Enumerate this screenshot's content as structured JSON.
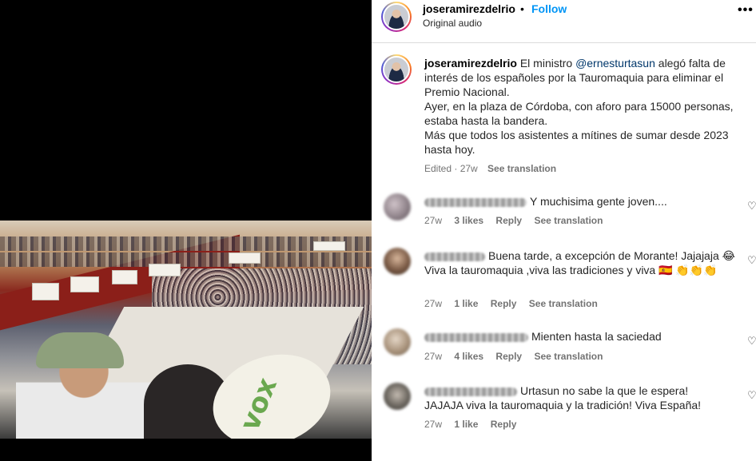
{
  "post": {
    "username": "joseramirezdelrio",
    "separator": "•",
    "follow_label": "Follow",
    "audio": "Original audio",
    "more_icon": "•••"
  },
  "video": {
    "fan_text": "vox"
  },
  "caption": {
    "username": "joseramirezdelrio",
    "text_before": " El ministro ",
    "mention": "@ernesturtasun",
    "text_after": " alegó falta de interés de los españoles por la Tauromaquia para eliminar el Premio Nacional.",
    "line2": "Ayer, en la plaza de Córdoba, con aforo para 15000 personas, estaba hasta la bandera.",
    "line3": "Más que todos los asistentes a mítines de sumar desde 2023 hasta hoy.",
    "edited": "Edited · 27w",
    "see_translation": "See translation"
  },
  "comments": [
    {
      "text": "Y muchisima gente joven....",
      "time": "27w",
      "likes": "3 likes",
      "reply": "Reply",
      "translation": "See translation",
      "avatar_color": "#8b7f86"
    },
    {
      "text": "Buena tarde, a excepción de Morante! Jajajaja 😂",
      "text2": "Viva la tauromaquia ,viva las tradiciones y viva 🇪🇸 👏👏👏",
      "time": "27w",
      "likes": "1 like",
      "reply": "Reply",
      "translation": "See translation",
      "avatar_color": "#7a5a45"
    },
    {
      "text": "Mienten hasta la saciedad",
      "time": "27w",
      "likes": "4 likes",
      "reply": "Reply",
      "translation": "See translation",
      "avatar_color": "#a9937c"
    },
    {
      "text": "Urtasun no sabe la que le espera!",
      "text2": "JAJAJA viva la tauromaquia y la tradición! Viva España!",
      "time": "27w",
      "likes": "1 like",
      "reply": "Reply",
      "avatar_color": "#6c6760"
    }
  ],
  "icons": {
    "heart": "♡"
  }
}
